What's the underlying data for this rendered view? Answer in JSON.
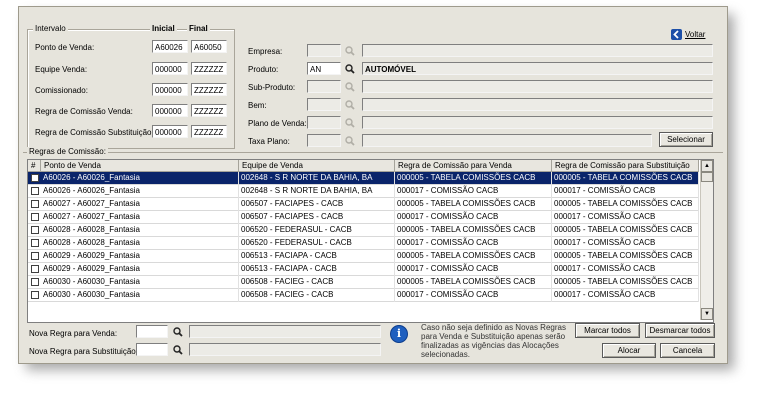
{
  "voltar": {
    "label": "Voltar"
  },
  "intervalo": {
    "title": "Intervalo",
    "col_inicial": "Inicial",
    "col_final": "Final",
    "rows": [
      {
        "label": "Ponto de Venda:",
        "inicial": "A60026",
        "final": "A60050"
      },
      {
        "label": "Equipe Venda:",
        "inicial": "000000",
        "final": "ZZZZZZ"
      },
      {
        "label": "Comissionado:",
        "inicial": "000000",
        "final": "ZZZZZZ"
      },
      {
        "label": "Regra de Comissão Venda:",
        "inicial": "000000",
        "final": "ZZZZZZ"
      },
      {
        "label": "Regra de Comissão Substituição:",
        "inicial": "000000",
        "final": "ZZZZZZ"
      }
    ]
  },
  "filters": [
    {
      "label": "Empresa:",
      "code": "",
      "desc": "",
      "enabled": false
    },
    {
      "label": "Produto:",
      "code": "AN",
      "desc": "AUTOMÓVEL",
      "enabled": true
    },
    {
      "label": "Sub-Produto:",
      "code": "",
      "desc": "",
      "enabled": false
    },
    {
      "label": "Bem:",
      "code": "",
      "desc": "",
      "enabled": false
    },
    {
      "label": "Plano de Venda:",
      "code": "",
      "desc": "",
      "enabled": false
    },
    {
      "label": "Taxa Plano:",
      "code": "",
      "desc": "",
      "enabled": false
    }
  ],
  "selecionar": {
    "label": "Selecionar"
  },
  "regras": {
    "title": "Regras de Comissão:",
    "columns": [
      "#",
      "Ponto de Venda",
      "Equipe de Venda",
      "Regra de Comissão para Venda",
      "Regra de Comissão para Substituição"
    ],
    "rows": [
      {
        "ponto": "A60026 - A60026_Fantasia",
        "equipe": "002648 - S R NORTE DA BAHIA, BA",
        "venda": "000005 - TABELA COMISSÕES CACB",
        "subst": "000005 - TABELA COMISSÕES CACB",
        "selected": true
      },
      {
        "ponto": "A60026 - A60026_Fantasia",
        "equipe": "002648 - S R NORTE DA BAHIA, BA",
        "venda": "000017 - COMISSÃO CACB",
        "subst": "000017 - COMISSÃO CACB",
        "selected": false
      },
      {
        "ponto": "A60027 - A60027_Fantasia",
        "equipe": "006507 - FACIAPES - CACB",
        "venda": "000005 - TABELA COMISSÕES CACB",
        "subst": "000005 - TABELA COMISSÕES CACB",
        "selected": false
      },
      {
        "ponto": "A60027 - A60027_Fantasia",
        "equipe": "006507 - FACIAPES - CACB",
        "venda": "000017 - COMISSÃO CACB",
        "subst": "000017 - COMISSÃO CACB",
        "selected": false
      },
      {
        "ponto": "A60028 - A60028_Fantasia",
        "equipe": "006520 - FEDERASUL - CACB",
        "venda": "000005 - TABELA COMISSÕES CACB",
        "subst": "000005 - TABELA COMISSÕES CACB",
        "selected": false
      },
      {
        "ponto": "A60028 - A60028_Fantasia",
        "equipe": "006520 - FEDERASUL - CACB",
        "venda": "000017 - COMISSÃO CACB",
        "subst": "000017 - COMISSÃO CACB",
        "selected": false
      },
      {
        "ponto": "A60029 - A60029_Fantasia",
        "equipe": "006513 - FACIAPA - CACB",
        "venda": "000005 - TABELA COMISSÕES CACB",
        "subst": "000005 - TABELA COMISSÕES CACB",
        "selected": false
      },
      {
        "ponto": "A60029 - A60029_Fantasia",
        "equipe": "006513 - FACIAPA - CACB",
        "venda": "000017 - COMISSÃO CACB",
        "subst": "000017 - COMISSÃO CACB",
        "selected": false
      },
      {
        "ponto": "A60030 - A60030_Fantasia",
        "equipe": "006508 - FACIEG - CACB",
        "venda": "000005 - TABELA COMISSÕES CACB",
        "subst": "000005 - TABELA COMISSÕES CACB",
        "selected": false
      },
      {
        "ponto": "A60030 - A60030_Fantasia",
        "equipe": "006508 - FACIEG - CACB",
        "venda": "000017 - COMISSÃO CACB",
        "subst": "000017 - COMISSÃO CACB",
        "selected": false
      }
    ]
  },
  "nova_regra_venda": {
    "label": "Nova Regra para Venda:",
    "code": "",
    "desc": ""
  },
  "nova_regra_subst": {
    "label": "Nova Regra para Substituição:",
    "code": "",
    "desc": ""
  },
  "info": {
    "icon": "info-icon",
    "lines": [
      "Caso não seja definido as Novas Regras",
      "para Venda e Substituição apenas serão",
      "finalizadas as vigências das Alocações",
      "selecionadas."
    ]
  },
  "buttons": {
    "marcar_todos": "Marcar todos",
    "desmarcar_todos": "Desmarcar todos",
    "alocar": "Alocar",
    "cancela": "Cancela"
  },
  "colors": {
    "selection": "#0a246a",
    "window": "#e6e4dc",
    "info_icon": "#1f5fbf"
  }
}
